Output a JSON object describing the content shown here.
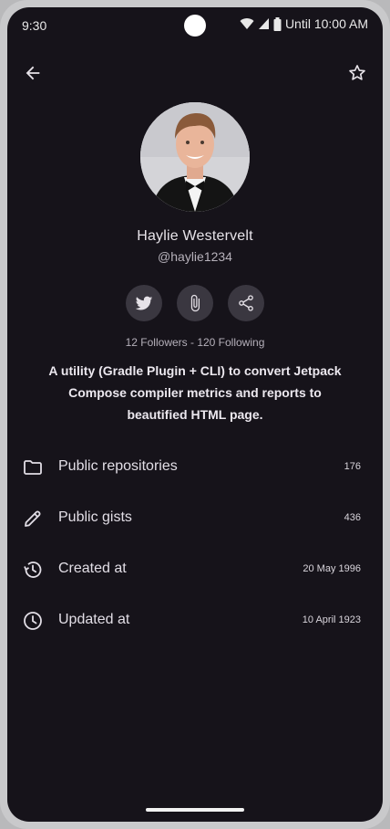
{
  "status_bar": {
    "time": "9:30",
    "until": "Until 10:00 AM"
  },
  "profile": {
    "name": "Haylie Westervelt",
    "handle": "@haylie1234",
    "followers_text": "12 Followers - 120 Following",
    "bio": "A utility (Gradle Plugin + CLI) to convert Jetpack Compose compiler metrics and reports to beautified HTML page."
  },
  "socials": [
    {
      "icon": "twitter-icon"
    },
    {
      "icon": "paperclip-icon"
    },
    {
      "icon": "share-icon"
    }
  ],
  "stats": [
    {
      "icon": "folder-icon",
      "label": "Public repositories",
      "value": "176"
    },
    {
      "icon": "pencil-icon",
      "label": "Public gists",
      "value": "436"
    },
    {
      "icon": "history-icon",
      "label": "Created at",
      "value": "20 May 1996"
    },
    {
      "icon": "clock-icon",
      "label": "Updated at",
      "value": "10 April 1923"
    }
  ],
  "colors": {
    "background": "#16131a",
    "chip": "#3a3740",
    "text": "#e7e3ea"
  }
}
